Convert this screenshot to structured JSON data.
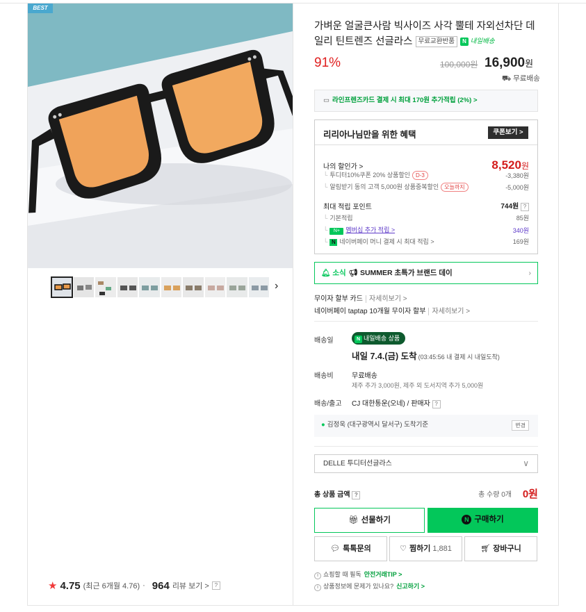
{
  "product": {
    "badge": "BEST",
    "title": "가벼운 얼굴큰사람 빅사이즈 사각 뿔테 자외선차단 데일리 틴트렌즈 선글라스",
    "tag_free_exchange": "무료교환반품",
    "tag_tomorrow": "내일배송",
    "discount": "91%",
    "original_price": "100,000원",
    "sale_price": "16,900",
    "price_unit": "원",
    "shipping": "무료배송"
  },
  "card_promo": "라인프렌즈카드 결제 시 최대 170원 추가적립 (2%) >",
  "benefits": {
    "heading": "리리아나님만을 위한 혜택",
    "coupon_button": "쿠폰보기 >",
    "my_price_label": "나의 할인가 >",
    "my_price_value": "8,520",
    "my_price_unit": "원",
    "discounts": [
      {
        "label": "투디터10%쿠폰 20% 상품할인",
        "pill": "D-3",
        "value": "-3,380원"
      },
      {
        "label": "알림받기 동의 고객 5,000원 상품중복할인",
        "pill": "오늘까지",
        "value": "-5,000원"
      }
    ],
    "points_label": "최대 적립 포인트",
    "points_value": "744원",
    "points": [
      {
        "label": "기본적립",
        "value": "85원"
      },
      {
        "label": "멤버십 추가 적립 >",
        "value": "340원"
      },
      {
        "label": "네이버페이 머니 결제 시 최대 적립 >",
        "value": "169원"
      }
    ]
  },
  "summer": {
    "notice": "소식",
    "text": "SUMMER 초특가 브랜드 데이"
  },
  "payments": [
    {
      "label": "무이자 할부 카드",
      "detail": "자세히보기 >"
    },
    {
      "label": "네이버페이 taptap 10개월 무이자 할부",
      "detail": "자세히보기 >"
    }
  ],
  "delivery": {
    "label": "배송일",
    "pill": "내일배송 상품",
    "arrive": "내일 7.4.(금) 도착",
    "arrive_note": "(03:45:56 내 결제 시 내일도착)",
    "fee_label": "배송비",
    "fee_value": "무료배송",
    "fee_note": "제주 추가 3,000원, 제주 외 도서지역 추가 5,000원",
    "carrier_label": "배송/출고",
    "carrier_value": "CJ 대한통운(오네) / 판매자",
    "address": "김정욱 (대구광역시 달서구) 도착기준",
    "change": "변경"
  },
  "option": {
    "selected": "DELLE 투디터선글라스"
  },
  "total": {
    "label": "총 상품 금액",
    "qty": "총 수량 0개",
    "amount": "0원"
  },
  "buttons": {
    "gift": "선물하기",
    "buy": "구매하기",
    "talk": "톡톡문의",
    "wish": "찜하기",
    "wish_count": "1,881",
    "cart": "장바구니"
  },
  "footer": [
    {
      "text": "쇼핑할 때 필독",
      "link": "안전거래TIP >"
    },
    {
      "text": "상품정보에 문제가 있나요?",
      "link": "신고하기 >"
    }
  ],
  "rating": {
    "score": "4.75",
    "recent": "(최근 6개월 4.76)",
    "dot": "·",
    "reviews": "964",
    "reviews_label": "리뷰 보기 >"
  },
  "icons": {
    "star": "star-icon",
    "arrow": "chevron-right-icon"
  }
}
